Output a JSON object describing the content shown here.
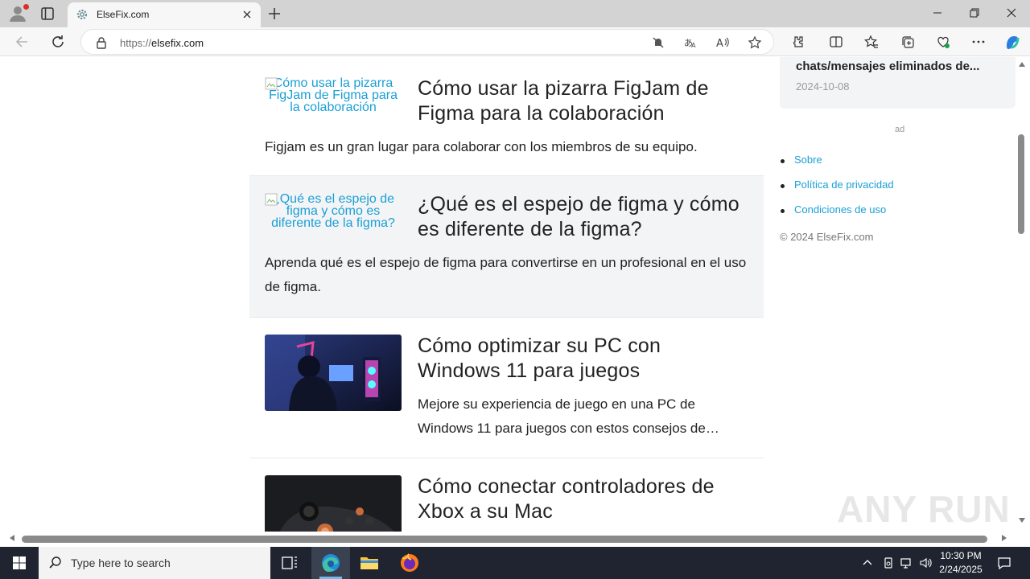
{
  "browser": {
    "tab": {
      "title": "ElseFix.com",
      "favicon": "gear-icon"
    },
    "address": {
      "protocol": "https://",
      "domain": "elsefix.com"
    }
  },
  "page": {
    "articles": [
      {
        "title": "Cómo usar la pizarra FigJam de Figma para la colaboración",
        "image_alt": "Cómo usar la pizarra FigJam de Figma para la colaboración",
        "excerpt": "Figjam es un gran lugar para colaborar con los miembros de su equipo."
      },
      {
        "title": "¿Qué es el espejo de figma y cómo es diferente de la figma?",
        "image_alt": "¿Qué es el espejo de figma y cómo es diferente de la figma?",
        "excerpt": "Aprenda qué es el espejo de figma para convertirse en un profesional en el uso de figma."
      },
      {
        "title": "Cómo optimizar su PC con Windows 11 para juegos",
        "excerpt": "Mejore su experiencia de juego en una PC de Windows 11 para juegos con estos consejos de…"
      },
      {
        "title": "Cómo conectar controladores de Xbox a su Mac"
      }
    ],
    "sidebar": {
      "card_title": "chats/mensajes eliminados de...",
      "card_date": "2024-10-08",
      "ad_label": "ad",
      "links": [
        "Sobre",
        "Política de privacidad",
        "Condiciones de uso"
      ],
      "copyright": "© 2024 ElseFix.com"
    },
    "watermark": "ANY RUN"
  },
  "taskbar": {
    "search_placeholder": "Type here to search",
    "time": "10:30 PM",
    "date": "2/24/2025"
  },
  "colors": {
    "link": "#1a9fd6",
    "alt_row": "#f3f4f6",
    "taskbar": "#1f2430",
    "chrome": "#d3d3d3"
  }
}
